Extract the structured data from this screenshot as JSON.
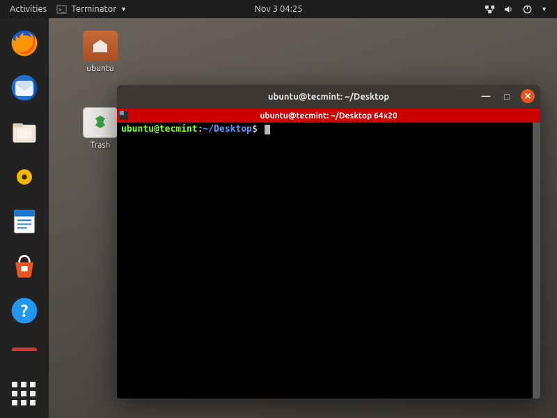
{
  "topbar": {
    "activities": "Activities",
    "app_name": "Terminator",
    "datetime": "Nov 3  04:25"
  },
  "desktop_icons": {
    "home": "ubuntu",
    "trash": "Trash"
  },
  "window": {
    "title": "ubuntu@tecmint: ~/Desktop",
    "tab": "ubuntu@tecmint: ~/Desktop 64x20",
    "prompt_user": "ubuntu@tecmint",
    "prompt_sep": ":",
    "prompt_path": "~/Desktop",
    "prompt_symbol": "$"
  }
}
